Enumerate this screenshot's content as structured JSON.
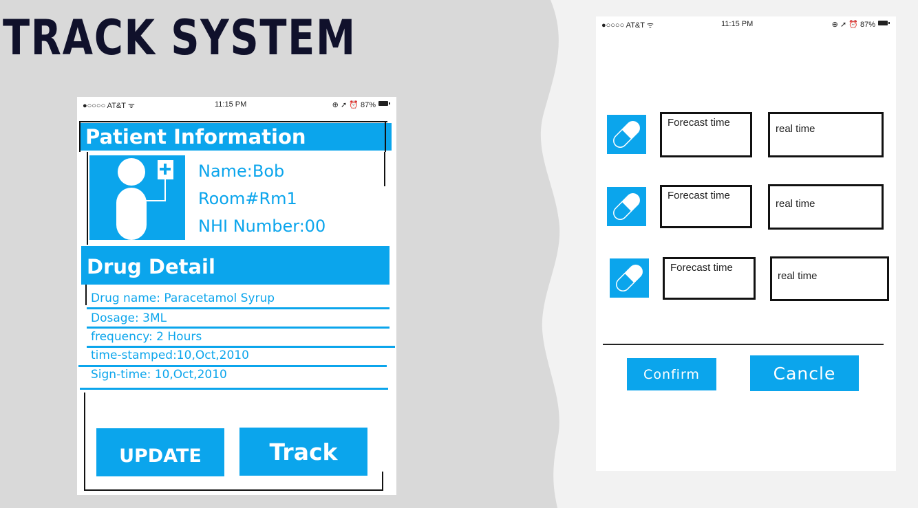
{
  "slide": {
    "title": "TRACK SYSTEM"
  },
  "status_bar": {
    "carrier": "●○○○○ AT&T ᯤ",
    "time": "11:15 PM",
    "battery": "⊕ ➚ ⏰ 87%"
  },
  "patient_screen": {
    "header": "Patient Information",
    "name": "Name:Bob",
    "room": "Room#Rm1",
    "nhi": "NHI Number:00",
    "drug_header": "Drug Detail",
    "details": [
      "Drug name: Paracetamol Syrup",
      "Dosage: 3ML",
      "frequency: 2 Hours",
      "time-stamped:10,Oct,2010",
      "Sign-time: 10,Oct,2010"
    ],
    "update_label": "UPDATE",
    "track_label": "Track"
  },
  "track_screen": {
    "rows": [
      {
        "forecast": "Forecast time",
        "real": "real time"
      },
      {
        "forecast": "Forecast time",
        "real": "real time"
      },
      {
        "forecast": "Forecast time",
        "real": "real time"
      }
    ],
    "confirm_label": "Confirm",
    "cancle_label": "Cancle"
  },
  "colors": {
    "accent": "#0ba5ec",
    "title": "#10112b",
    "background": "#f2f2f2",
    "wave": "#d9d9d9"
  },
  "icons": [
    "pill-icon",
    "patient-iv-icon",
    "wifi-icon",
    "battery-icon"
  ]
}
